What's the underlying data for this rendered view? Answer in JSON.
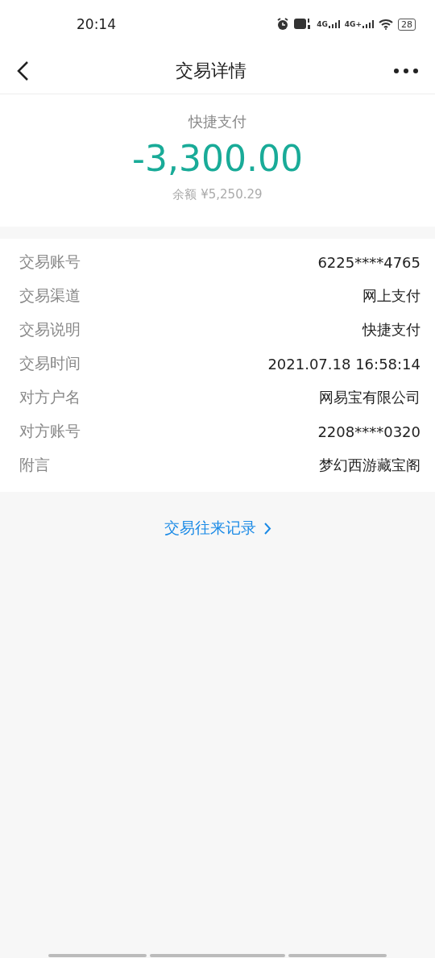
{
  "status_bar": {
    "time": "20:14",
    "network_1": "4G",
    "network_2": "4G+",
    "battery": "28"
  },
  "nav": {
    "title": "交易详情"
  },
  "summary": {
    "type": "快捷支付",
    "amount": "-3,300.00",
    "balance": "余额 ¥5,250.29"
  },
  "details": [
    {
      "label": "交易账号",
      "value": "6225****4765"
    },
    {
      "label": "交易渠道",
      "value": "网上支付"
    },
    {
      "label": "交易说明",
      "value": "快捷支付"
    },
    {
      "label": "交易时间",
      "value": "2021.07.18 16:58:14"
    },
    {
      "label": "对方户名",
      "value": "网易宝有限公司"
    },
    {
      "label": "对方账号",
      "value": "2208****0320"
    },
    {
      "label": "附言",
      "value": "梦幻西游藏宝阁"
    }
  ],
  "link": {
    "label": "交易往来记录"
  }
}
